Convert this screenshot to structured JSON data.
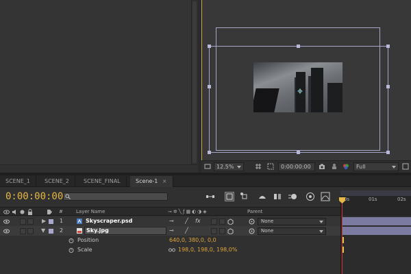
{
  "viewer": {
    "zoom": "12.5%",
    "timecode": "0:00:00:00",
    "resolution": "Full"
  },
  "tabs": [
    {
      "label": "SCENE_1"
    },
    {
      "label": "SCENE_2"
    },
    {
      "label": "SCENE_FINAL"
    },
    {
      "label": "Scene-1",
      "active": true
    }
  ],
  "timeline": {
    "timecode": "0:00:00:00",
    "columns": {
      "number": "#",
      "layer_name": "Layer Name",
      "parent": "Parent"
    },
    "ruler": [
      "0s",
      "01s",
      "02s"
    ],
    "layers": [
      {
        "number": "1",
        "name": "Skyscraper.psd",
        "fx": "fx",
        "parent": "None"
      },
      {
        "number": "2",
        "name": "Sky.jpg",
        "parent": "None"
      }
    ],
    "properties": [
      {
        "name": "Position",
        "value": "640,0, 380,0, 0,0"
      },
      {
        "name": "Scale",
        "value": "198,0, 198,0, 198,0%"
      }
    ]
  },
  "colors": {
    "accent": "#e8b845",
    "label_swatch": "#a8a8cc",
    "playhead": "#d63030"
  }
}
